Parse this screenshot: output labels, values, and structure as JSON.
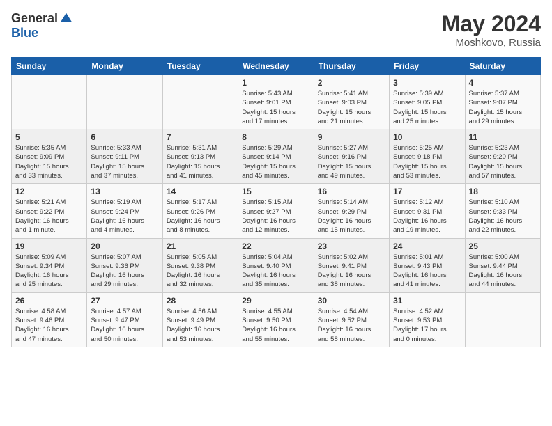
{
  "logo": {
    "general": "General",
    "blue": "Blue"
  },
  "title": {
    "month": "May 2024",
    "location": "Moshkovo, Russia"
  },
  "weekdays": [
    "Sunday",
    "Monday",
    "Tuesday",
    "Wednesday",
    "Thursday",
    "Friday",
    "Saturday"
  ],
  "weeks": [
    [
      {
        "num": "",
        "info": ""
      },
      {
        "num": "",
        "info": ""
      },
      {
        "num": "",
        "info": ""
      },
      {
        "num": "1",
        "info": "Sunrise: 5:43 AM\nSunset: 9:01 PM\nDaylight: 15 hours\nand 17 minutes."
      },
      {
        "num": "2",
        "info": "Sunrise: 5:41 AM\nSunset: 9:03 PM\nDaylight: 15 hours\nand 21 minutes."
      },
      {
        "num": "3",
        "info": "Sunrise: 5:39 AM\nSunset: 9:05 PM\nDaylight: 15 hours\nand 25 minutes."
      },
      {
        "num": "4",
        "info": "Sunrise: 5:37 AM\nSunset: 9:07 PM\nDaylight: 15 hours\nand 29 minutes."
      }
    ],
    [
      {
        "num": "5",
        "info": "Sunrise: 5:35 AM\nSunset: 9:09 PM\nDaylight: 15 hours\nand 33 minutes."
      },
      {
        "num": "6",
        "info": "Sunrise: 5:33 AM\nSunset: 9:11 PM\nDaylight: 15 hours\nand 37 minutes."
      },
      {
        "num": "7",
        "info": "Sunrise: 5:31 AM\nSunset: 9:13 PM\nDaylight: 15 hours\nand 41 minutes."
      },
      {
        "num": "8",
        "info": "Sunrise: 5:29 AM\nSunset: 9:14 PM\nDaylight: 15 hours\nand 45 minutes."
      },
      {
        "num": "9",
        "info": "Sunrise: 5:27 AM\nSunset: 9:16 PM\nDaylight: 15 hours\nand 49 minutes."
      },
      {
        "num": "10",
        "info": "Sunrise: 5:25 AM\nSunset: 9:18 PM\nDaylight: 15 hours\nand 53 minutes."
      },
      {
        "num": "11",
        "info": "Sunrise: 5:23 AM\nSunset: 9:20 PM\nDaylight: 15 hours\nand 57 minutes."
      }
    ],
    [
      {
        "num": "12",
        "info": "Sunrise: 5:21 AM\nSunset: 9:22 PM\nDaylight: 16 hours\nand 1 minute."
      },
      {
        "num": "13",
        "info": "Sunrise: 5:19 AM\nSunset: 9:24 PM\nDaylight: 16 hours\nand 4 minutes."
      },
      {
        "num": "14",
        "info": "Sunrise: 5:17 AM\nSunset: 9:26 PM\nDaylight: 16 hours\nand 8 minutes."
      },
      {
        "num": "15",
        "info": "Sunrise: 5:15 AM\nSunset: 9:27 PM\nDaylight: 16 hours\nand 12 minutes."
      },
      {
        "num": "16",
        "info": "Sunrise: 5:14 AM\nSunset: 9:29 PM\nDaylight: 16 hours\nand 15 minutes."
      },
      {
        "num": "17",
        "info": "Sunrise: 5:12 AM\nSunset: 9:31 PM\nDaylight: 16 hours\nand 19 minutes."
      },
      {
        "num": "18",
        "info": "Sunrise: 5:10 AM\nSunset: 9:33 PM\nDaylight: 16 hours\nand 22 minutes."
      }
    ],
    [
      {
        "num": "19",
        "info": "Sunrise: 5:09 AM\nSunset: 9:34 PM\nDaylight: 16 hours\nand 25 minutes."
      },
      {
        "num": "20",
        "info": "Sunrise: 5:07 AM\nSunset: 9:36 PM\nDaylight: 16 hours\nand 29 minutes."
      },
      {
        "num": "21",
        "info": "Sunrise: 5:05 AM\nSunset: 9:38 PM\nDaylight: 16 hours\nand 32 minutes."
      },
      {
        "num": "22",
        "info": "Sunrise: 5:04 AM\nSunset: 9:40 PM\nDaylight: 16 hours\nand 35 minutes."
      },
      {
        "num": "23",
        "info": "Sunrise: 5:02 AM\nSunset: 9:41 PM\nDaylight: 16 hours\nand 38 minutes."
      },
      {
        "num": "24",
        "info": "Sunrise: 5:01 AM\nSunset: 9:43 PM\nDaylight: 16 hours\nand 41 minutes."
      },
      {
        "num": "25",
        "info": "Sunrise: 5:00 AM\nSunset: 9:44 PM\nDaylight: 16 hours\nand 44 minutes."
      }
    ],
    [
      {
        "num": "26",
        "info": "Sunrise: 4:58 AM\nSunset: 9:46 PM\nDaylight: 16 hours\nand 47 minutes."
      },
      {
        "num": "27",
        "info": "Sunrise: 4:57 AM\nSunset: 9:47 PM\nDaylight: 16 hours\nand 50 minutes."
      },
      {
        "num": "28",
        "info": "Sunrise: 4:56 AM\nSunset: 9:49 PM\nDaylight: 16 hours\nand 53 minutes."
      },
      {
        "num": "29",
        "info": "Sunrise: 4:55 AM\nSunset: 9:50 PM\nDaylight: 16 hours\nand 55 minutes."
      },
      {
        "num": "30",
        "info": "Sunrise: 4:54 AM\nSunset: 9:52 PM\nDaylight: 16 hours\nand 58 minutes."
      },
      {
        "num": "31",
        "info": "Sunrise: 4:52 AM\nSunset: 9:53 PM\nDaylight: 17 hours\nand 0 minutes."
      },
      {
        "num": "",
        "info": ""
      }
    ]
  ]
}
